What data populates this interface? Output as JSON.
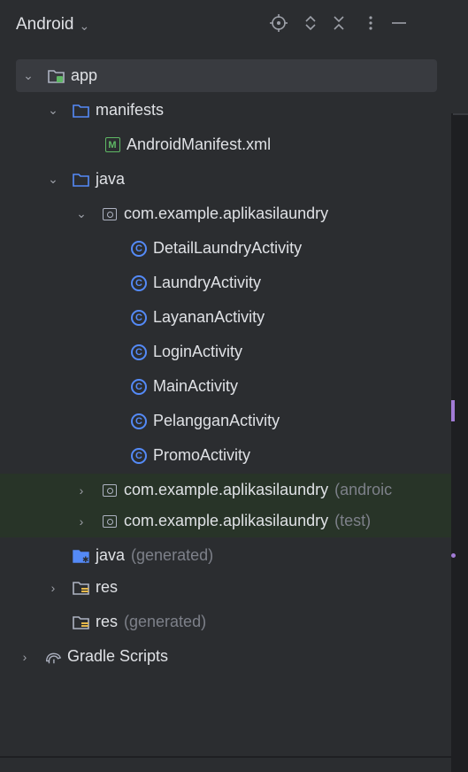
{
  "header": {
    "title": "Android",
    "view_dropdown_icon": "chevron-down-icon",
    "actions": [
      "locate-icon",
      "expand-all-icon",
      "collapse-all-icon",
      "more-options-icon",
      "minimize-icon"
    ]
  },
  "tree": {
    "app": "app",
    "manifests": "manifests",
    "manifest_file": "AndroidManifest.xml",
    "java": "java",
    "package_main": "com.example.aplikasilaundry",
    "classes": [
      "DetailLaundryActivity",
      "LaundryActivity",
      "LayananActivity",
      "LoginActivity",
      "MainActivity",
      "PelangganActivity",
      "PromoActivity"
    ],
    "package_android_test": "com.example.aplikasilaundry",
    "package_android_test_suffix": "(androic",
    "package_test": "com.example.aplikasilaundry",
    "package_test_suffix": "(test)",
    "java_generated": "java",
    "java_generated_suffix": "(generated)",
    "res": "res",
    "res_generated": "res",
    "res_generated_suffix": "(generated)",
    "gradle_scripts": "Gradle Scripts"
  },
  "colors": {
    "background": "#2b2d30",
    "selection": "#393b40",
    "test_highlight": "#283428",
    "class_icon": "#548af7",
    "manifest_icon": "#5fb865",
    "folder_icon": "#548af7",
    "muted_text": "#7d8089"
  }
}
